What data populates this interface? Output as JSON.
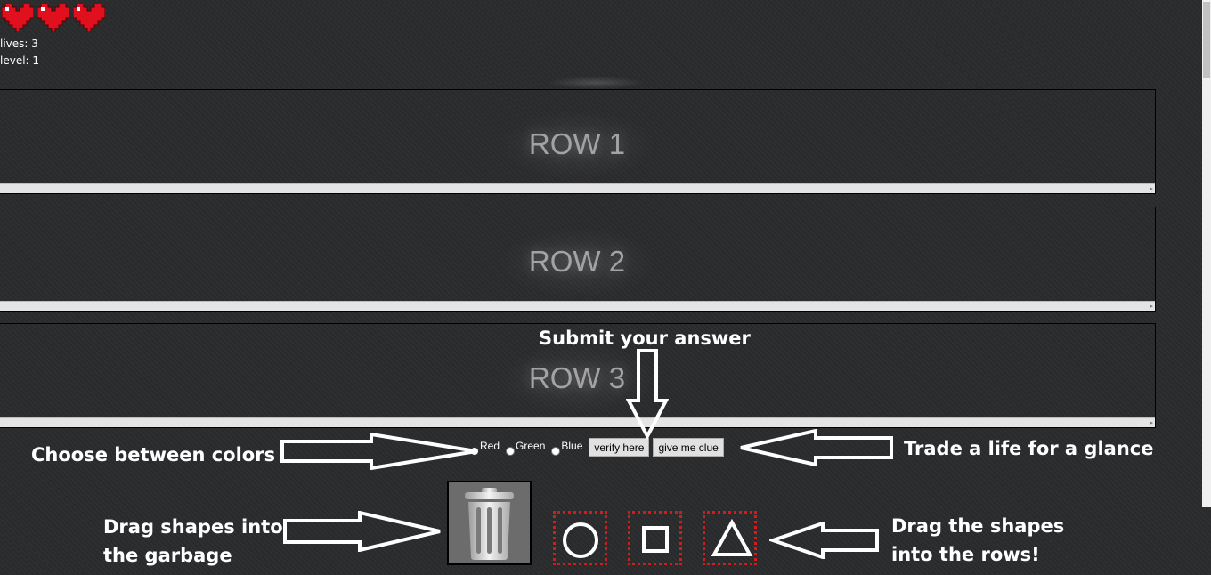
{
  "hud": {
    "lives_text": "lives: 3",
    "level_text": "level: 1",
    "hearts": [
      "heart-icon",
      "heart-icon",
      "heart-icon"
    ]
  },
  "rows": [
    {
      "label": "ROW 1"
    },
    {
      "label": "ROW 2"
    },
    {
      "label": "ROW 3"
    }
  ],
  "controls": {
    "colors": [
      {
        "label": "Red",
        "selected": true
      },
      {
        "label": "Green",
        "selected": false
      },
      {
        "label": "Blue",
        "selected": false
      }
    ],
    "verify_label": "verify here",
    "clue_label": "give me clue"
  },
  "annotations": {
    "submit": "Submit your answer",
    "choose": "Choose between colors",
    "trade": "Trade a life for a glance",
    "garbage_line1": "Drag shapes into",
    "garbage_line2": "the garbage",
    "rows_line1": "Drag the shapes",
    "rows_line2": "into the rows!"
  },
  "palette": {
    "heart": "#e0101e",
    "shape_border": "#d01d1d",
    "background": "#2a2b2d"
  },
  "shapes": [
    "circle-icon",
    "square-icon",
    "triangle-icon"
  ]
}
